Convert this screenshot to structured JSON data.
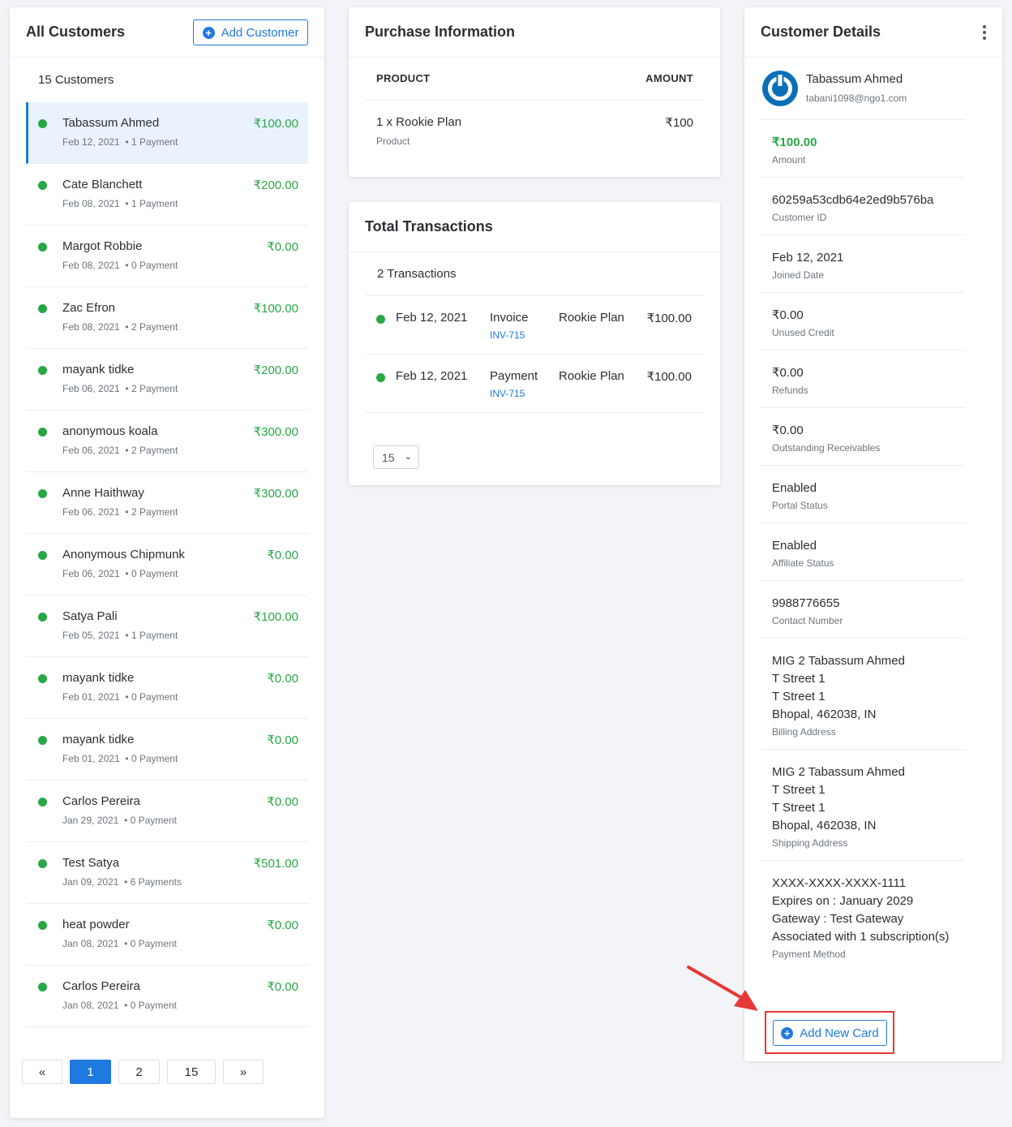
{
  "customers": {
    "title": "All Customers",
    "add_label": "Add Customer",
    "count": "15 Customers",
    "items": [
      {
        "name": "Tabassum Ahmed",
        "date": "Feb 12, 2021",
        "payments": "• 1 Payment",
        "amount": "₹100.00"
      },
      {
        "name": "Cate Blanchett",
        "date": "Feb 08, 2021",
        "payments": "• 1 Payment",
        "amount": "₹200.00"
      },
      {
        "name": "Margot Robbie",
        "date": "Feb 08, 2021",
        "payments": "• 0 Payment",
        "amount": "₹0.00"
      },
      {
        "name": "Zac Efron",
        "date": "Feb 08, 2021",
        "payments": "• 2 Payment",
        "amount": "₹100.00"
      },
      {
        "name": "mayank tidke",
        "date": "Feb 06, 2021",
        "payments": "• 2 Payment",
        "amount": "₹200.00"
      },
      {
        "name": "anonymous koala",
        "date": "Feb 06, 2021",
        "payments": "• 2 Payment",
        "amount": "₹300.00"
      },
      {
        "name": "Anne Haithway",
        "date": "Feb 06, 2021",
        "payments": "• 2 Payment",
        "amount": "₹300.00"
      },
      {
        "name": "Anonymous Chipmunk",
        "date": "Feb 06, 2021",
        "payments": "• 0 Payment",
        "amount": "₹0.00"
      },
      {
        "name": "Satya Pali",
        "date": "Feb 05, 2021",
        "payments": "• 1 Payment",
        "amount": "₹100.00"
      },
      {
        "name": "mayank tidke",
        "date": "Feb 01, 2021",
        "payments": "• 0 Payment",
        "amount": "₹0.00"
      },
      {
        "name": "mayank tidke",
        "date": "Feb 01, 2021",
        "payments": "• 0 Payment",
        "amount": "₹0.00"
      },
      {
        "name": "Carlos Pereira",
        "date": "Jan 29, 2021",
        "payments": "• 0 Payment",
        "amount": "₹0.00"
      },
      {
        "name": "Test Satya",
        "date": "Jan 09, 2021",
        "payments": "• 6 Payments",
        "amount": "₹501.00"
      },
      {
        "name": "heat powder",
        "date": "Jan 08, 2021",
        "payments": "• 0 Payment",
        "amount": "₹0.00"
      },
      {
        "name": "Carlos Pereira",
        "date": "Jan 08, 2021",
        "payments": "• 0 Payment",
        "amount": "₹0.00"
      }
    ],
    "pagination": {
      "prev": "«",
      "pages": [
        "1",
        "2",
        "15"
      ],
      "current": "1",
      "next": "»"
    }
  },
  "purchase": {
    "title": "Purchase Information",
    "col_product": "PRODUCT",
    "col_amount": "AMOUNT",
    "item_name": "1 x Rookie Plan",
    "item_type": "Product",
    "item_amount": "₹100"
  },
  "transactions": {
    "title": "Total Transactions",
    "count": "2 Transactions",
    "items": [
      {
        "date": "Feb 12, 2021",
        "type": "Invoice",
        "ref": "INV-715",
        "plan": "Rookie Plan",
        "amount": "₹100.00"
      },
      {
        "date": "Feb 12, 2021",
        "type": "Payment",
        "ref": "INV-715",
        "plan": "Rookie Plan",
        "amount": "₹100.00"
      }
    ],
    "per_page": "15"
  },
  "details": {
    "title": "Customer Details",
    "name": "Tabassum Ahmed",
    "email": "tabani1098@ngo1.com",
    "fields": [
      {
        "value": "₹100.00",
        "label": "Amount"
      },
      {
        "value": "60259a53cdb64e2ed9b576ba",
        "label": "Customer ID"
      },
      {
        "value": "Feb 12, 2021",
        "label": "Joined Date"
      },
      {
        "value": "₹0.00",
        "label": "Unused Credit"
      },
      {
        "value": "₹0.00",
        "label": "Refunds"
      },
      {
        "value": "₹0.00",
        "label": "Outstanding Receivables"
      },
      {
        "value": "Enabled",
        "label": "Portal Status"
      },
      {
        "value": "Enabled",
        "label": "Affiliate Status"
      },
      {
        "value": "9988776655",
        "label": "Contact Number"
      }
    ],
    "billing": {
      "lines": [
        "MIG 2 Tabassum Ahmed",
        "T Street 1",
        "T Street 1",
        "Bhopal, 462038, IN"
      ],
      "label": "Billing Address"
    },
    "shipping": {
      "lines": [
        "MIG 2 Tabassum Ahmed",
        "T Street 1",
        "T Street 1",
        "Bhopal, 462038, IN"
      ],
      "label": "Shipping Address"
    },
    "payment": {
      "lines": [
        "XXXX-XXXX-XXXX-1111",
        "Expires on : January 2029",
        "Gateway : Test Gateway",
        "Associated with 1 subscription(s)"
      ],
      "label": "Payment Method"
    },
    "add_card_label": "Add New Card"
  },
  "colors": {
    "accent": "#1f7ae0",
    "success": "#28a745",
    "annotation": "#e53935"
  }
}
